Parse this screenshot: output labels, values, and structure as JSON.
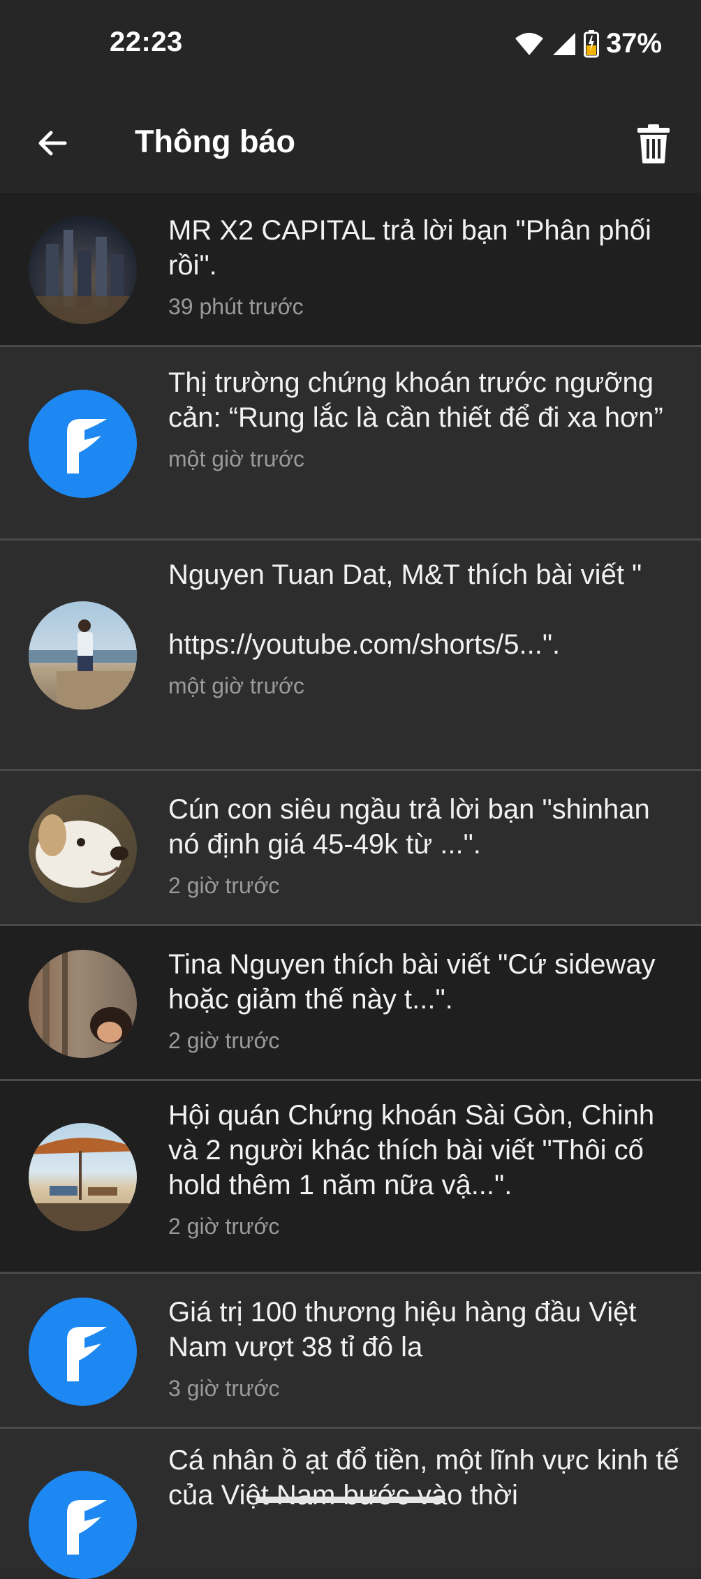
{
  "status_bar": {
    "time": "22:23",
    "battery": "37%"
  },
  "app_bar": {
    "title": "Thông báo",
    "back_icon": "arrow-left-icon",
    "trash_icon": "trash-icon"
  },
  "notifications": [
    {
      "message": "MR X2 CAPITAL trả lời bạn \"Phân phối rồi\".",
      "time": "39 phút trước",
      "avatar": "city-night-photo"
    },
    {
      "message": "Thị trường chứng khoán trước ngưỡng cản: “Rung lắc là cần thiết để đi xa hơn”",
      "time": "một giờ trước",
      "avatar": "app-logo"
    },
    {
      "message": "Nguyen Tuan Dat, M&T thích bài viết \"\n\nhttps://youtube.com/shorts/5...\".",
      "time": "một giờ trước",
      "avatar": "man-at-sea-photo"
    },
    {
      "message": "Cún con siêu ngầu trả lời bạn \"shinhan nó định giá 45-49k từ ...\".",
      "time": "2 giờ trước",
      "avatar": "dog-photo"
    },
    {
      "message": "Tina Nguyen thích bài viết \"Cứ sideway hoặc giảm thế này t...\".",
      "time": "2 giờ trước",
      "avatar": "woman-photo"
    },
    {
      "message": "Hội quán Chứng khoán Sài Gòn, Chinh và 2 người khác thích bài viết \"Thôi cố hold thêm 1 năm nữa vậ...\".",
      "time": "2 giờ trước",
      "avatar": "beach-umbrella-photo"
    },
    {
      "message": "Giá trị 100 thương hiệu hàng đầu Việt Nam vượt 38 tỉ đô la",
      "time": "3 giờ trước",
      "avatar": "app-logo"
    },
    {
      "message": "Cá nhân ồ ạt đổ tiền, một lĩnh vực kinh tế của Việt Nam bước vào thời",
      "time": "",
      "avatar": "app-logo"
    }
  ]
}
